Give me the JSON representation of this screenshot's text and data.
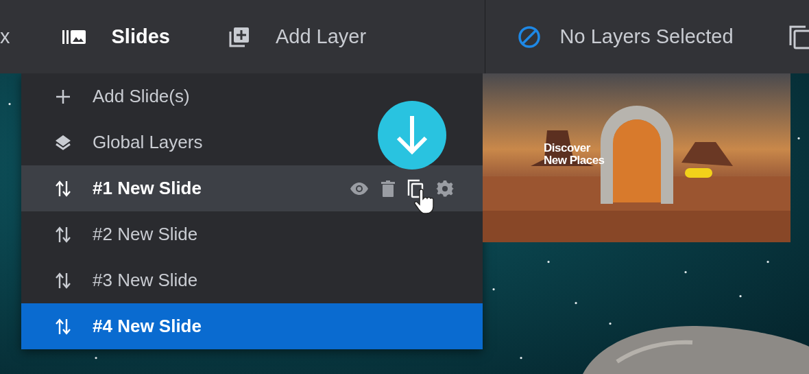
{
  "toolbar": {
    "cut_label": "x",
    "items": [
      {
        "label": "Slides",
        "kind": "slides",
        "selected": true
      },
      {
        "label": "Add Layer",
        "kind": "add-layer",
        "selected": false
      }
    ],
    "selection_status": "No Layers Selected"
  },
  "slide_menu": {
    "actions": [
      {
        "label": "Add Slide(s)",
        "kind": "add"
      },
      {
        "label": "Global Layers",
        "kind": "layers"
      }
    ],
    "slides": [
      {
        "label": "#1 New Slide",
        "hovered": true,
        "selected": false
      },
      {
        "label": "#2 New Slide",
        "hovered": false,
        "selected": false
      },
      {
        "label": "#3 New Slide",
        "hovered": false,
        "selected": false
      },
      {
        "label": "#4 New Slide",
        "hovered": false,
        "selected": true
      }
    ]
  },
  "preview": {
    "headline": "Discover New Places"
  }
}
